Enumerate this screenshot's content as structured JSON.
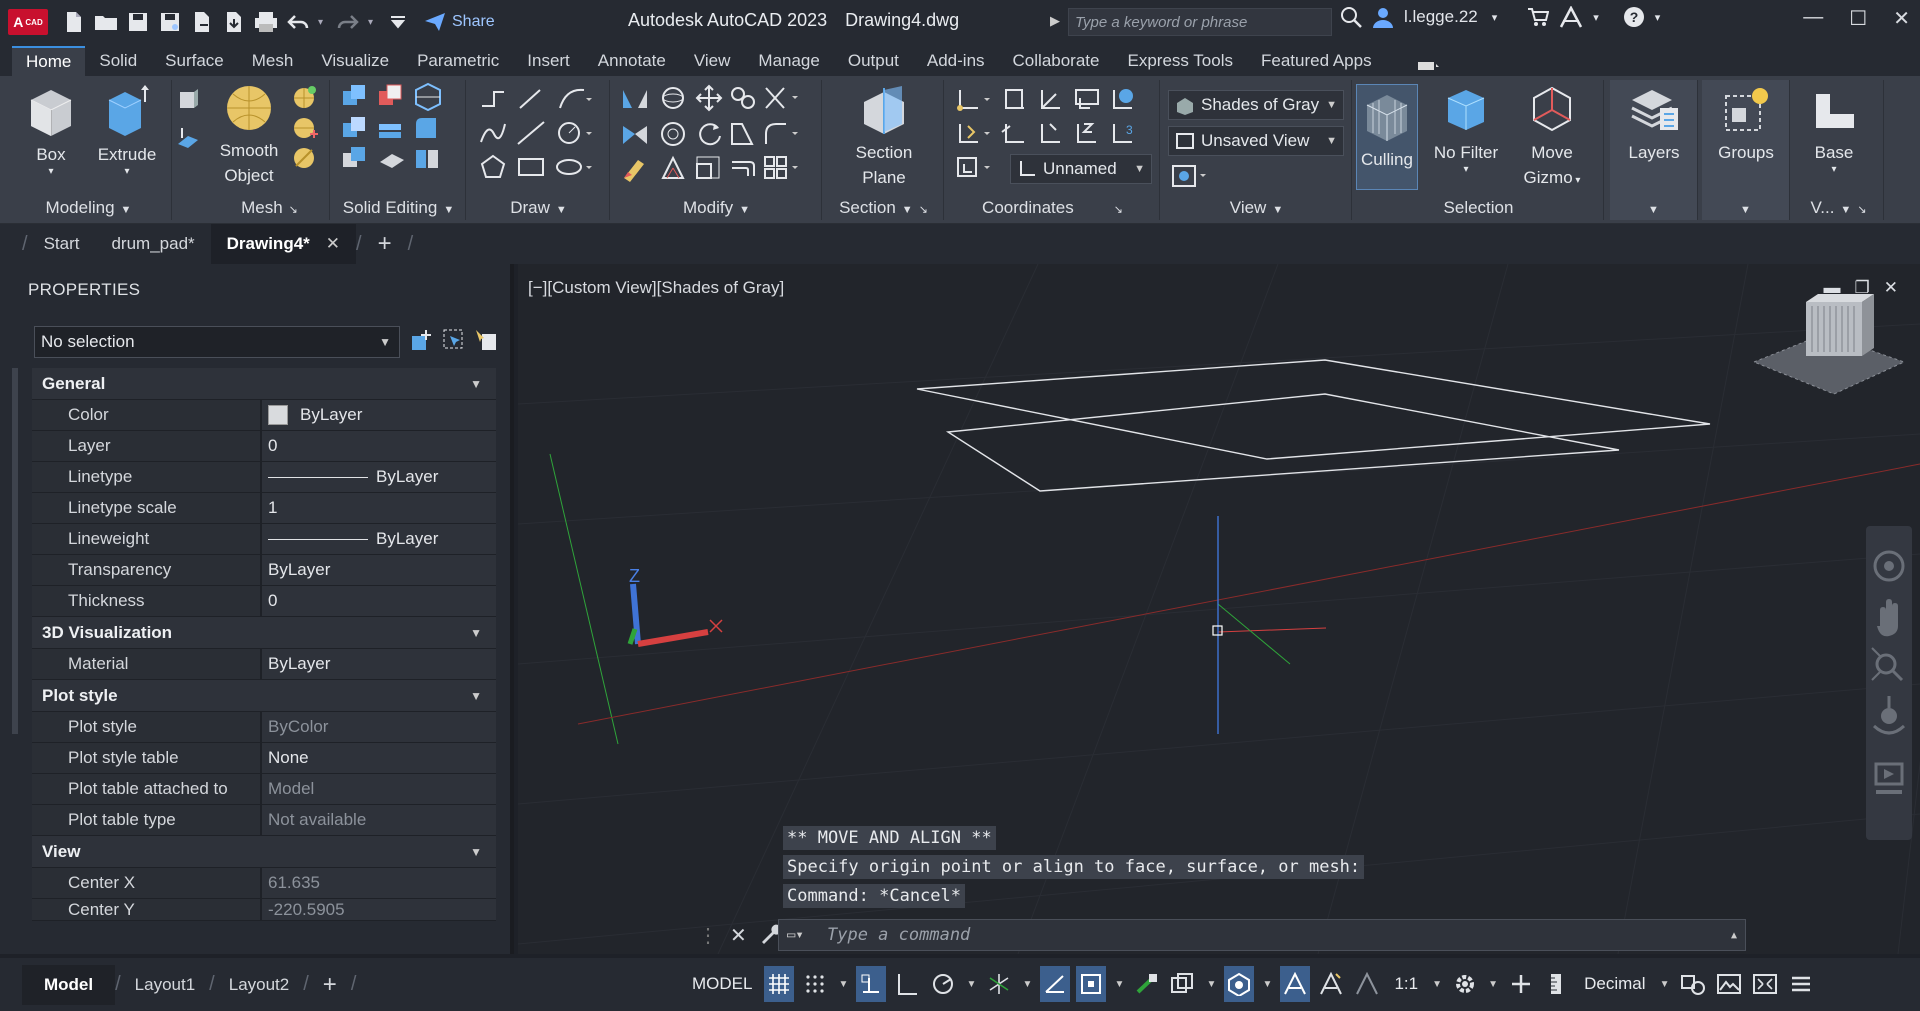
{
  "app": {
    "logo_text": "A",
    "logo_sub": "CAD",
    "title": "Autodesk AutoCAD 2023",
    "filename": "Drawing4.dwg",
    "share_label": "Share",
    "search_placeholder": "Type a keyword or phrase",
    "user": "l.legge.22"
  },
  "ribbon_tabs": [
    "Home",
    "Solid",
    "Surface",
    "Mesh",
    "Visualize",
    "Parametric",
    "Insert",
    "Annotate",
    "View",
    "Manage",
    "Output",
    "Add-ins",
    "Collaborate",
    "Express Tools",
    "Featured Apps"
  ],
  "ribbon": {
    "modeling": {
      "title": "Modeling",
      "box": "Box",
      "extrude": "Extrude"
    },
    "mesh": {
      "title": "Mesh",
      "smooth_line1": "Smooth",
      "smooth_line2": "Object"
    },
    "solid_editing": {
      "title": "Solid Editing"
    },
    "draw": {
      "title": "Draw"
    },
    "modify": {
      "title": "Modify"
    },
    "section": {
      "title": "Section",
      "btn_line1": "Section",
      "btn_line2": "Plane"
    },
    "coordinates": {
      "title": "Coordinates",
      "ucs_name": "Unnamed"
    },
    "view": {
      "title": "View",
      "visual_style": "Shades of Gray",
      "saved_view": "Unsaved View"
    },
    "selection": {
      "title": "Selection",
      "culling": "Culling",
      "no_filter": "No Filter",
      "move_gizmo_line1": "Move",
      "move_gizmo_line2": "Gizmo"
    },
    "layers": {
      "label": "Layers"
    },
    "groups": {
      "label": "Groups"
    },
    "base": {
      "label": "Base",
      "title": "V..."
    }
  },
  "file_tabs": {
    "start": "Start",
    "drum": "drum_pad*",
    "drawing": "Drawing4*",
    "close": "✕",
    "add": "+"
  },
  "properties": {
    "header": "PROPERTIES",
    "selection": "No selection",
    "sections": {
      "general": "General",
      "viz": "3D Visualization",
      "plot": "Plot style",
      "view": "View"
    },
    "general": [
      {
        "k": "Color",
        "v": "ByLayer"
      },
      {
        "k": "Layer",
        "v": "0"
      },
      {
        "k": "Linetype",
        "v": "ByLayer"
      },
      {
        "k": "Linetype scale",
        "v": "1"
      },
      {
        "k": "Lineweight",
        "v": "ByLayer"
      },
      {
        "k": "Transparency",
        "v": "ByLayer"
      },
      {
        "k": "Thickness",
        "v": "0"
      }
    ],
    "viz": [
      {
        "k": "Material",
        "v": "ByLayer"
      }
    ],
    "plot": [
      {
        "k": "Plot style",
        "v": "ByColor"
      },
      {
        "k": "Plot style table",
        "v": "None"
      },
      {
        "k": "Plot table attached to",
        "v": "Model"
      },
      {
        "k": "Plot table type",
        "v": "Not available"
      }
    ],
    "view": [
      {
        "k": "Center X",
        "v": "61.635"
      },
      {
        "k": "Center Y",
        "v": "-220.5905"
      }
    ]
  },
  "viewport": {
    "label": "[−][Custom View][Shades of Gray]",
    "axis_z": "Z"
  },
  "command": {
    "line1": "** MOVE AND ALIGN **",
    "line2": "Specify origin point or align to face, surface, or mesh:",
    "line3": "Command: *Cancel*",
    "placeholder": "Type a command"
  },
  "status": {
    "model_tab": "Model",
    "layout1": "Layout1",
    "layout2": "Layout2",
    "add": "+",
    "model_btn": "MODEL",
    "scale": "1:1",
    "units": "Decimal"
  },
  "colors": {
    "accent": "#3b8fe0",
    "logo": "#c8102e",
    "status_on": "#3c5f8d"
  }
}
